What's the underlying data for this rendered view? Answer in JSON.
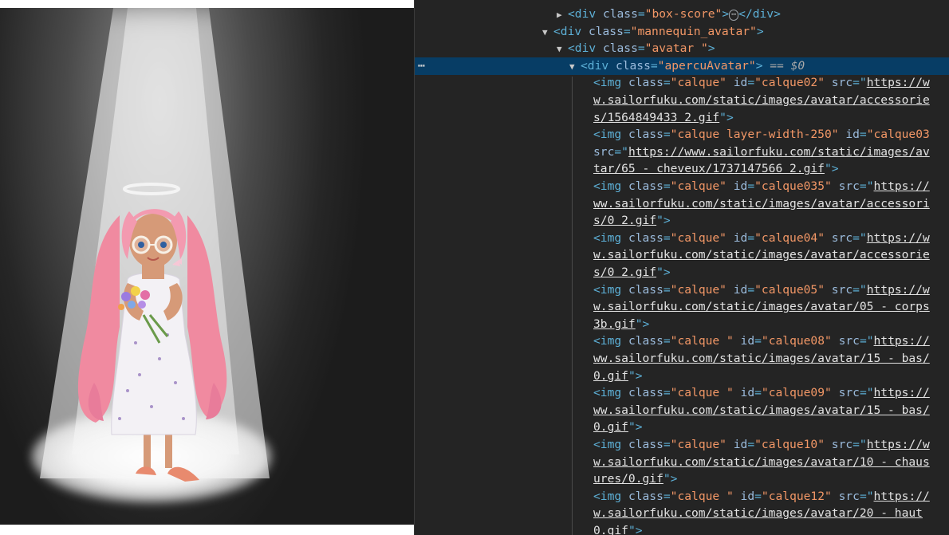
{
  "devtools": {
    "lines": [
      {
        "indent": 178,
        "segs": [
          {
            "t": "tri",
            "v": "▶"
          },
          {
            "t": "tag",
            "v": "<div "
          },
          {
            "t": "attr",
            "v": "class"
          },
          {
            "t": "tag",
            "v": "="
          },
          {
            "t": "val",
            "v": "\"box-score\""
          },
          {
            "t": "tag",
            "v": ">"
          },
          {
            "t": "dots",
            "v": "⋯"
          },
          {
            "t": "tag",
            "v": "</div>"
          }
        ]
      },
      {
        "indent": 160,
        "segs": [
          {
            "t": "tri",
            "v": "▼"
          },
          {
            "t": "tag",
            "v": "<div "
          },
          {
            "t": "attr",
            "v": "class"
          },
          {
            "t": "tag",
            "v": "="
          },
          {
            "t": "val",
            "v": "\"mannequin_avatar\""
          },
          {
            "t": "tag",
            "v": ">"
          }
        ]
      },
      {
        "indent": 178,
        "segs": [
          {
            "t": "tri",
            "v": "▼"
          },
          {
            "t": "tag",
            "v": "<div "
          },
          {
            "t": "attr",
            "v": "class"
          },
          {
            "t": "tag",
            "v": "="
          },
          {
            "t": "val",
            "v": "\"avatar \""
          },
          {
            "t": "tag",
            "v": ">"
          }
        ]
      },
      {
        "indent": 194,
        "selected": true,
        "segs": [
          {
            "t": "tri",
            "v": "▼"
          },
          {
            "t": "tag",
            "v": "<div "
          },
          {
            "t": "attr",
            "v": "class"
          },
          {
            "t": "tag",
            "v": "="
          },
          {
            "t": "val",
            "v": "\"apercuAvatar\""
          },
          {
            "t": "tag",
            "v": ">"
          },
          {
            "t": "eq",
            "v": " == "
          },
          {
            "t": "dollar",
            "v": "$0"
          }
        ]
      },
      {
        "indent": 224,
        "segs": [
          {
            "t": "tag",
            "v": "<img "
          },
          {
            "t": "attr",
            "v": "class"
          },
          {
            "t": "tag",
            "v": "="
          },
          {
            "t": "val",
            "v": "\"calque\" "
          },
          {
            "t": "attr",
            "v": "id"
          },
          {
            "t": "tag",
            "v": "="
          },
          {
            "t": "val",
            "v": "\"calque02\" "
          },
          {
            "t": "attr",
            "v": "src"
          },
          {
            "t": "tag",
            "v": "=\""
          },
          {
            "t": "lnk",
            "v": "https://w"
          }
        ]
      },
      {
        "indent": 224,
        "segs": [
          {
            "t": "lnk",
            "v": "w.sailorfuku.com/static/images/avatar/accessorie"
          }
        ]
      },
      {
        "indent": 224,
        "segs": [
          {
            "t": "lnk",
            "v": "s/1564849433 2.gif"
          },
          {
            "t": "tag",
            "v": "\">"
          }
        ]
      },
      {
        "indent": 224,
        "segs": [
          {
            "t": "tag",
            "v": "<img "
          },
          {
            "t": "attr",
            "v": "class"
          },
          {
            "t": "tag",
            "v": "="
          },
          {
            "t": "val",
            "v": "\"calque layer-width-250\" "
          },
          {
            "t": "attr",
            "v": "id"
          },
          {
            "t": "tag",
            "v": "="
          },
          {
            "t": "val",
            "v": "\"calque03"
          }
        ]
      },
      {
        "indent": 224,
        "segs": [
          {
            "t": "attr",
            "v": "src"
          },
          {
            "t": "tag",
            "v": "=\""
          },
          {
            "t": "lnk",
            "v": "https://www.sailorfuku.com/static/images/av"
          }
        ]
      },
      {
        "indent": 224,
        "segs": [
          {
            "t": "lnk",
            "v": "tar/65 - cheveux/1737147566 2.gif"
          },
          {
            "t": "tag",
            "v": "\">"
          }
        ]
      },
      {
        "indent": 224,
        "segs": [
          {
            "t": "tag",
            "v": "<img "
          },
          {
            "t": "attr",
            "v": "class"
          },
          {
            "t": "tag",
            "v": "="
          },
          {
            "t": "val",
            "v": "\"calque\" "
          },
          {
            "t": "attr",
            "v": "id"
          },
          {
            "t": "tag",
            "v": "="
          },
          {
            "t": "val",
            "v": "\"calque035\" "
          },
          {
            "t": "attr",
            "v": "src"
          },
          {
            "t": "tag",
            "v": "=\""
          },
          {
            "t": "lnk",
            "v": "https://"
          }
        ]
      },
      {
        "indent": 224,
        "segs": [
          {
            "t": "lnk",
            "v": "ww.sailorfuku.com/static/images/avatar/accessori"
          }
        ]
      },
      {
        "indent": 224,
        "segs": [
          {
            "t": "lnk",
            "v": "s/0 2.gif"
          },
          {
            "t": "tag",
            "v": "\">"
          }
        ]
      },
      {
        "indent": 224,
        "segs": [
          {
            "t": "tag",
            "v": "<img "
          },
          {
            "t": "attr",
            "v": "class"
          },
          {
            "t": "tag",
            "v": "="
          },
          {
            "t": "val",
            "v": "\"calque\" "
          },
          {
            "t": "attr",
            "v": "id"
          },
          {
            "t": "tag",
            "v": "="
          },
          {
            "t": "val",
            "v": "\"calque04\" "
          },
          {
            "t": "attr",
            "v": "src"
          },
          {
            "t": "tag",
            "v": "=\""
          },
          {
            "t": "lnk",
            "v": "https://w"
          }
        ]
      },
      {
        "indent": 224,
        "segs": [
          {
            "t": "lnk",
            "v": "w.sailorfuku.com/static/images/avatar/accessorie"
          }
        ]
      },
      {
        "indent": 224,
        "segs": [
          {
            "t": "lnk",
            "v": "s/0 2.gif"
          },
          {
            "t": "tag",
            "v": "\">"
          }
        ]
      },
      {
        "indent": 224,
        "segs": [
          {
            "t": "tag",
            "v": "<img "
          },
          {
            "t": "attr",
            "v": "class"
          },
          {
            "t": "tag",
            "v": "="
          },
          {
            "t": "val",
            "v": "\"calque\" "
          },
          {
            "t": "attr",
            "v": "id"
          },
          {
            "t": "tag",
            "v": "="
          },
          {
            "t": "val",
            "v": "\"calque05\" "
          },
          {
            "t": "attr",
            "v": "src"
          },
          {
            "t": "tag",
            "v": "=\""
          },
          {
            "t": "lnk",
            "v": "https://w"
          }
        ]
      },
      {
        "indent": 224,
        "segs": [
          {
            "t": "lnk",
            "v": "w.sailorfuku.com/static/images/avatar/05 - corps"
          }
        ]
      },
      {
        "indent": 224,
        "segs": [
          {
            "t": "lnk",
            "v": "3b.gif"
          },
          {
            "t": "tag",
            "v": "\">"
          }
        ]
      },
      {
        "indent": 224,
        "segs": [
          {
            "t": "tag",
            "v": "<img "
          },
          {
            "t": "attr",
            "v": "class"
          },
          {
            "t": "tag",
            "v": "="
          },
          {
            "t": "val",
            "v": "\"calque \" "
          },
          {
            "t": "attr",
            "v": "id"
          },
          {
            "t": "tag",
            "v": "="
          },
          {
            "t": "val",
            "v": "\"calque08\" "
          },
          {
            "t": "attr",
            "v": "src"
          },
          {
            "t": "tag",
            "v": "=\""
          },
          {
            "t": "lnk",
            "v": "https://"
          }
        ]
      },
      {
        "indent": 224,
        "segs": [
          {
            "t": "lnk",
            "v": "ww.sailorfuku.com/static/images/avatar/15 - bas/"
          }
        ]
      },
      {
        "indent": 224,
        "segs": [
          {
            "t": "lnk",
            "v": "0.gif"
          },
          {
            "t": "tag",
            "v": "\">"
          }
        ]
      },
      {
        "indent": 224,
        "segs": [
          {
            "t": "tag",
            "v": "<img "
          },
          {
            "t": "attr",
            "v": "class"
          },
          {
            "t": "tag",
            "v": "="
          },
          {
            "t": "val",
            "v": "\"calque \" "
          },
          {
            "t": "attr",
            "v": "id"
          },
          {
            "t": "tag",
            "v": "="
          },
          {
            "t": "val",
            "v": "\"calque09\" "
          },
          {
            "t": "attr",
            "v": "src"
          },
          {
            "t": "tag",
            "v": "=\""
          },
          {
            "t": "lnk",
            "v": "https://"
          }
        ]
      },
      {
        "indent": 224,
        "segs": [
          {
            "t": "lnk",
            "v": "ww.sailorfuku.com/static/images/avatar/15 - bas/"
          }
        ]
      },
      {
        "indent": 224,
        "segs": [
          {
            "t": "lnk",
            "v": "0.gif"
          },
          {
            "t": "tag",
            "v": "\">"
          }
        ]
      },
      {
        "indent": 224,
        "segs": [
          {
            "t": "tag",
            "v": "<img "
          },
          {
            "t": "attr",
            "v": "class"
          },
          {
            "t": "tag",
            "v": "="
          },
          {
            "t": "val",
            "v": "\"calque\" "
          },
          {
            "t": "attr",
            "v": "id"
          },
          {
            "t": "tag",
            "v": "="
          },
          {
            "t": "val",
            "v": "\"calque10\" "
          },
          {
            "t": "attr",
            "v": "src"
          },
          {
            "t": "tag",
            "v": "=\""
          },
          {
            "t": "lnk",
            "v": "https://w"
          }
        ]
      },
      {
        "indent": 224,
        "segs": [
          {
            "t": "lnk",
            "v": "w.sailorfuku.com/static/images/avatar/10 - chaus"
          }
        ]
      },
      {
        "indent": 224,
        "segs": [
          {
            "t": "lnk",
            "v": "ures/0.gif"
          },
          {
            "t": "tag",
            "v": "\">"
          }
        ]
      },
      {
        "indent": 224,
        "segs": [
          {
            "t": "tag",
            "v": "<img "
          },
          {
            "t": "attr",
            "v": "class"
          },
          {
            "t": "tag",
            "v": "="
          },
          {
            "t": "val",
            "v": "\"calque \" "
          },
          {
            "t": "attr",
            "v": "id"
          },
          {
            "t": "tag",
            "v": "="
          },
          {
            "t": "val",
            "v": "\"calque12\" "
          },
          {
            "t": "attr",
            "v": "src"
          },
          {
            "t": "tag",
            "v": "=\""
          },
          {
            "t": "lnk",
            "v": "https://"
          }
        ]
      },
      {
        "indent": 224,
        "segs": [
          {
            "t": "lnk",
            "v": "w.sailorfuku.com/static/images/avatar/20 - haut"
          }
        ]
      },
      {
        "indent": 224,
        "segs": [
          {
            "t": "lnk",
            "v": "0.gif"
          },
          {
            "t": "tag",
            "v": "\">"
          }
        ]
      }
    ],
    "selected_gutter": "⋯"
  },
  "colors": {
    "devtools_bg": "#242424",
    "selected_row": "#073d65",
    "tag": "#5db0d7",
    "attr": "#9bbbdc",
    "value": "#f29766"
  }
}
